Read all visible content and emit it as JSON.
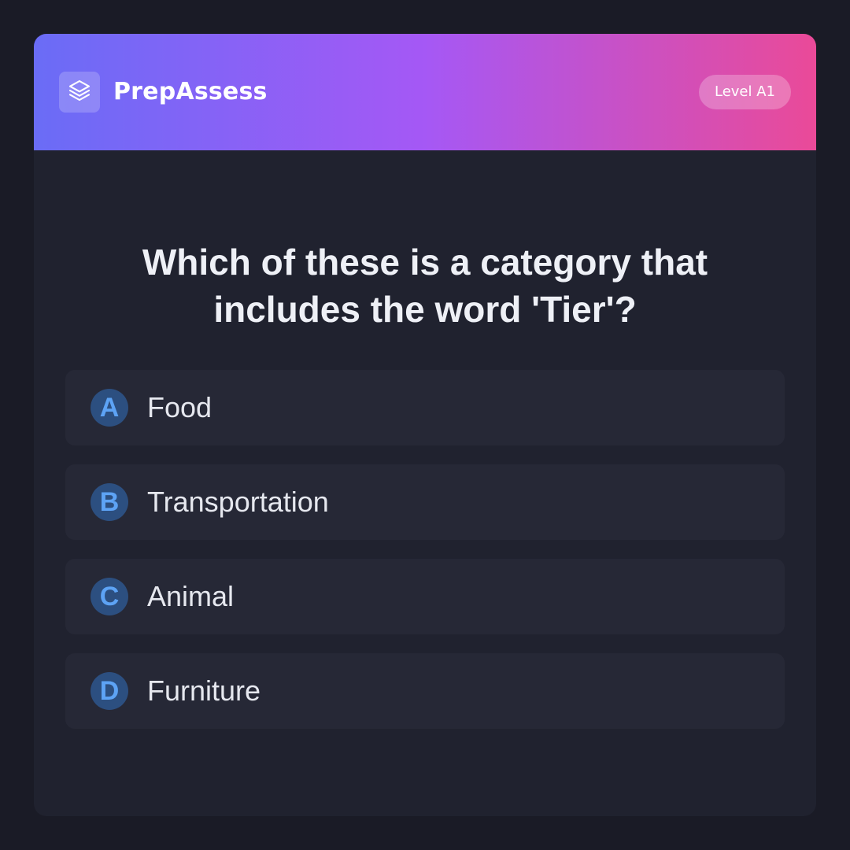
{
  "header": {
    "brand": "PrepAssess",
    "logo_icon": "layers-icon",
    "level_badge": "Level A1",
    "gradient": [
      "#6a6cf6",
      "#a558f5",
      "#ea4a98"
    ]
  },
  "question": {
    "text": "Which of these is a category that includes the word 'Tier'?"
  },
  "options": [
    {
      "letter": "A",
      "label": "Food"
    },
    {
      "letter": "B",
      "label": "Transportation"
    },
    {
      "letter": "C",
      "label": "Animal"
    },
    {
      "letter": "D",
      "label": "Furniture"
    }
  ],
  "colors": {
    "background": "#1a1b26",
    "card": "#20222f",
    "option_bg": "#262836",
    "letter_bg": "#2c4f80",
    "letter_fg": "#5da3f5"
  }
}
